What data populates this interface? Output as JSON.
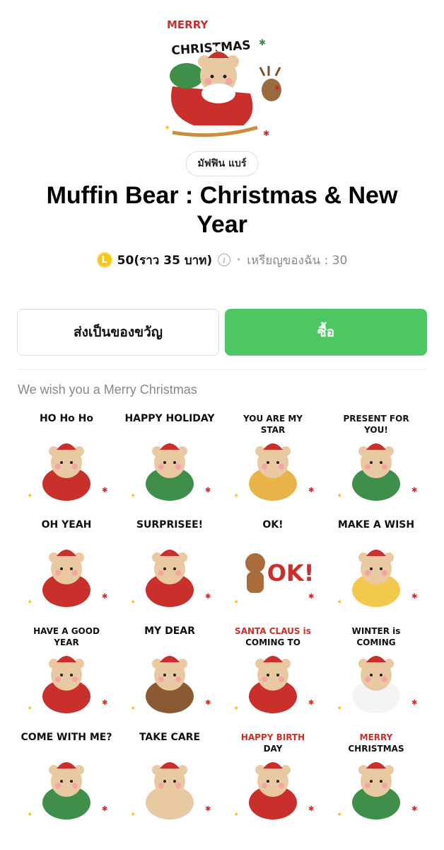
{
  "hero": {
    "lettering": "MERRY CHRISTMAS"
  },
  "author": "มัฟฟิน แบร์",
  "title": "Muffin Bear : Christmas & New Year",
  "price": {
    "coin_symbol": "L",
    "amount": "50(ราว 35 บาท)",
    "info_symbol": "i",
    "separator": "•",
    "my_coins": "เหรียญของฉัน : 30"
  },
  "buttons": {
    "gift": "ส่งเป็นของขวัญ",
    "buy": "ซื้อ"
  },
  "description": "We wish you a Merry Christmas",
  "colors": {
    "buy_green": "#4cc764",
    "coin_yellow": "#f5c518",
    "santa_red": "#c9302c",
    "bear_tan": "#e8c9a1",
    "wreath_green": "#3f8f4a"
  },
  "stickers": [
    {
      "caption": "HO Ho Ho",
      "icon": "santa-beard-bear"
    },
    {
      "caption": "HAPPY HOLIDAY",
      "icon": "wreath-bear"
    },
    {
      "caption": "YOU ARE MY STAR",
      "icon": "star-bear"
    },
    {
      "caption": "PRESENT FOR YOU!",
      "icon": "santa-wreath-bear"
    },
    {
      "caption": "OH YEAH",
      "icon": "mug-bear"
    },
    {
      "caption": "SURPRISEE!",
      "icon": "gift-bear"
    },
    {
      "caption": "OK!",
      "icon": "gingerbread"
    },
    {
      "caption": "MAKE A WISH",
      "icon": "duck-bear"
    },
    {
      "caption": "HAVE A GOOD YEAR",
      "icon": "stocking-bear"
    },
    {
      "caption": "MY DEAR",
      "icon": "reindeer-bear"
    },
    {
      "caption": "SANTA CLAUS is COMING TO TOWN!!",
      "icon": "sleigh-bear"
    },
    {
      "caption": "WINTER is COMING",
      "icon": "snowman-bear"
    },
    {
      "caption": "COME WITH ME?",
      "icon": "tree-bear"
    },
    {
      "caption": "TAKE CARE",
      "icon": "bowtie-bear"
    },
    {
      "caption": "HAPPY BIRTH DAY",
      "icon": "cake-bear"
    },
    {
      "caption": "MERRY CHRISTMAS",
      "icon": "tree-costume-bear"
    }
  ]
}
